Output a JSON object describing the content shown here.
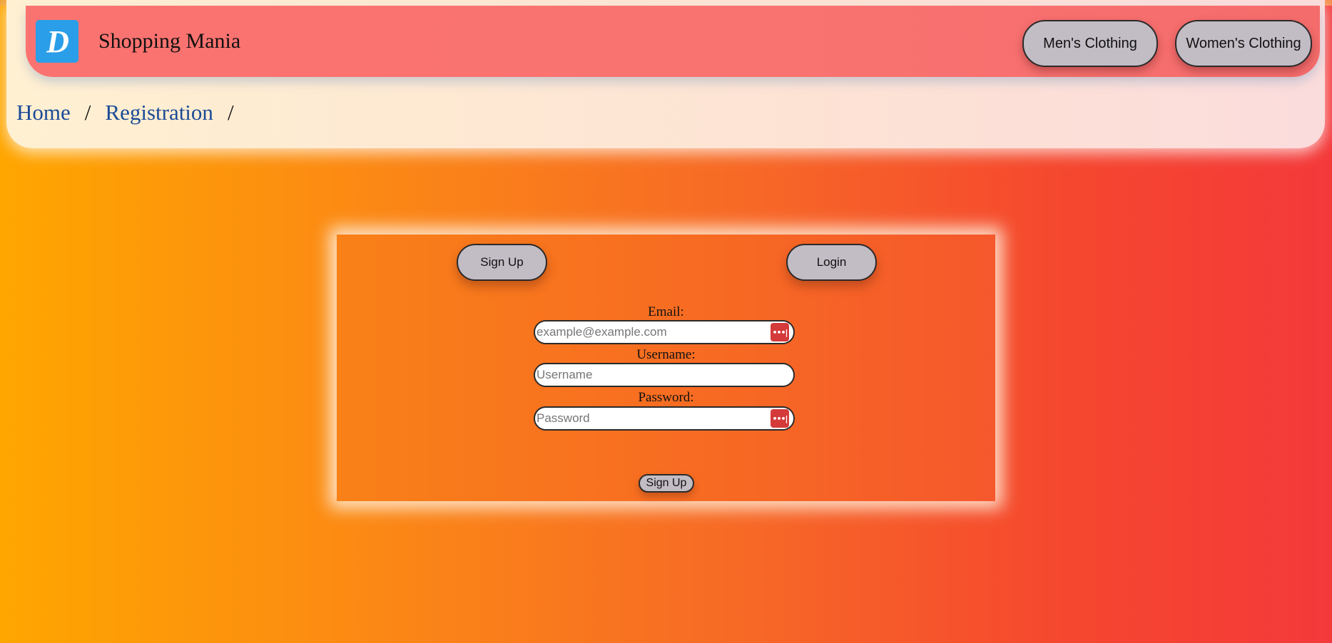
{
  "header": {
    "brand": "Shopping Mania",
    "logo_letter": "D",
    "nav": {
      "mens": "Men's Clothing",
      "womens": "Women's Clothing"
    }
  },
  "breadcrumb": {
    "items": [
      "Home",
      "Registration"
    ],
    "separator": "/"
  },
  "form": {
    "tabs": {
      "signup": "Sign Up",
      "login": "Login"
    },
    "email": {
      "label": "Email:",
      "placeholder": "example@example.com",
      "value": ""
    },
    "username": {
      "label": "Username:",
      "placeholder": "Username",
      "value": ""
    },
    "password": {
      "label": "Password:",
      "placeholder": "Password",
      "value": ""
    },
    "password_manager_icon": "password-manager-icon",
    "submit_label": "Sign Up"
  },
  "colors": {
    "navbar": "#fa7370",
    "logo": "#2a9ee8",
    "link": "#1b4a96",
    "button": "#c2bcc4",
    "password_icon": "#d43a3a"
  }
}
